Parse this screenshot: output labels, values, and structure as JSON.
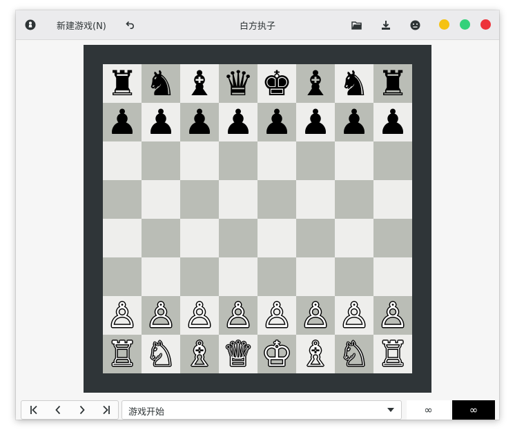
{
  "header": {
    "new_game_label": "新建游戏(N)",
    "title": "白方执子",
    "icons": {
      "app": "app-logo-icon",
      "undo": "undo-icon",
      "open": "open-folder-icon",
      "save": "save-download-icon",
      "claim_draw": "resign-face-icon"
    },
    "window_controls": [
      {
        "name": "minimize",
        "color": "#f5c211"
      },
      {
        "name": "maximize",
        "color": "#33d17a"
      },
      {
        "name": "close",
        "color": "#ed333b"
      }
    ]
  },
  "colors": {
    "board_frame": "#2f3538",
    "light_square": "#eeeeec",
    "dark_square": "#babdb6"
  },
  "board": {
    "rows": [
      [
        "♜",
        "♞",
        "♝",
        "♛",
        "♚",
        "♝",
        "♞",
        "♜"
      ],
      [
        "♟",
        "♟",
        "♟",
        "♟",
        "♟",
        "♟",
        "♟",
        "♟"
      ],
      [
        "",
        "",
        "",
        "",
        "",
        "",
        "",
        ""
      ],
      [
        "",
        "",
        "",
        "",
        "",
        "",
        "",
        ""
      ],
      [
        "",
        "",
        "",
        "",
        "",
        "",
        "",
        ""
      ],
      [
        "",
        "",
        "",
        "",
        "",
        "",
        "",
        ""
      ],
      [
        "♙",
        "♙",
        "♙",
        "♙",
        "♙",
        "♙",
        "♙",
        "♙"
      ],
      [
        "♖",
        "♘",
        "♗",
        "♕",
        "♔",
        "♗",
        "♘",
        "♖"
      ]
    ]
  },
  "bottom": {
    "history_value": "游戏开始",
    "white_clock": "∞",
    "black_clock": "∞",
    "nav_icons": [
      "first-move-icon",
      "previous-move-icon",
      "next-move-icon",
      "last-move-icon"
    ]
  }
}
